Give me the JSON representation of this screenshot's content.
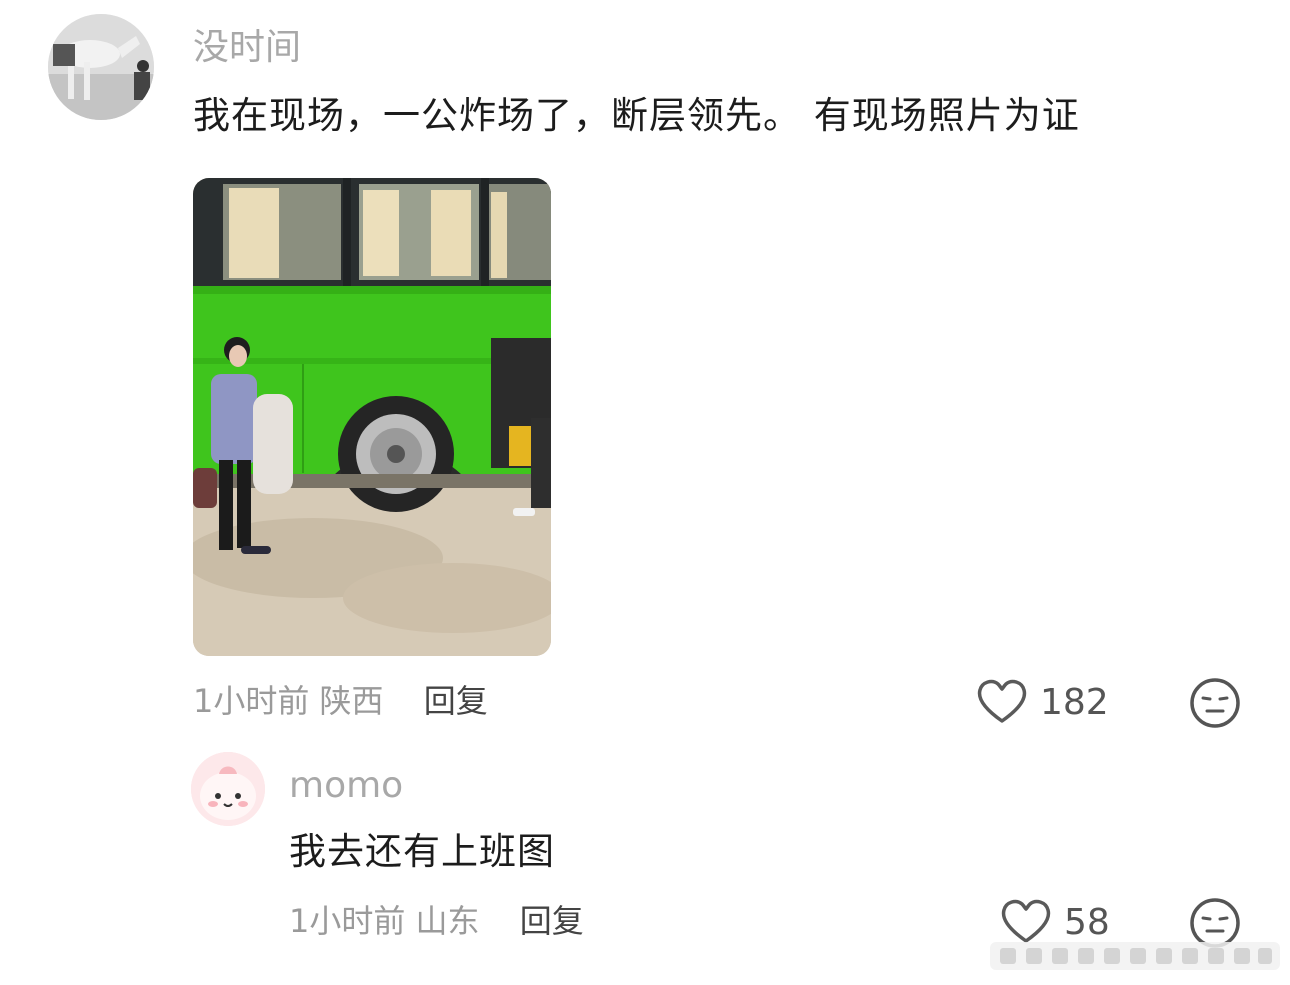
{
  "comment": {
    "username": "没时间",
    "text": "我在现场，一公炸场了，断层领先。 有现场照片为证",
    "time": "1小时前",
    "location": "陕西",
    "reply_label": "回复",
    "likes": "182"
  },
  "reply": {
    "username": "momo",
    "text": "我去还有上班图",
    "time": "1小时前",
    "location": "山东",
    "reply_label": "回复",
    "likes": "58"
  },
  "icons": {
    "like": "heart-outline-icon",
    "reaction": "neutral-face-icon"
  },
  "colors": {
    "bus_green": "#3fc51d",
    "meta_gray": "#9a9a9a"
  }
}
